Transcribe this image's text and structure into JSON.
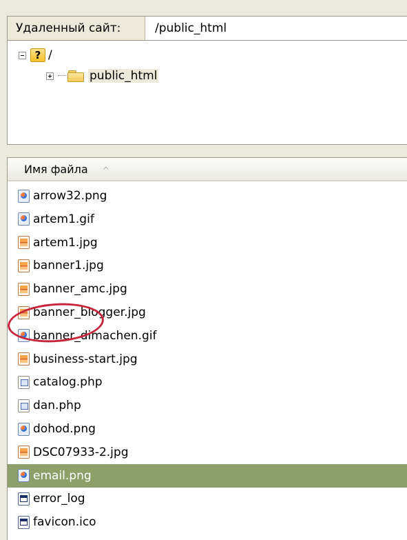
{
  "remote_site": {
    "label": "Удаленный сайт:",
    "path": "/public_html"
  },
  "tree": {
    "root_label": "/",
    "child_label": "public_html"
  },
  "file_list": {
    "column_header": "Имя файла",
    "sort_indicator": "^",
    "selected_index": 12,
    "files": [
      {
        "name": "arrow32.png",
        "icon": "png-file-icon"
      },
      {
        "name": "artem1.gif",
        "icon": "gif-file-icon"
      },
      {
        "name": "artem1.jpg",
        "icon": "jpg-file-icon"
      },
      {
        "name": "banner1.jpg",
        "icon": "jpg-file-icon"
      },
      {
        "name": "banner_amc.jpg",
        "icon": "jpg-file-icon"
      },
      {
        "name": "banner_blogger.jpg",
        "icon": "jpg-file-icon"
      },
      {
        "name": "banner_dimachen.gif",
        "icon": "gif-file-icon"
      },
      {
        "name": "business-start.jpg",
        "icon": "jpg-file-icon"
      },
      {
        "name": "catalog.php",
        "icon": "php-file-icon"
      },
      {
        "name": "dan.php",
        "icon": "php-file-icon"
      },
      {
        "name": "dohod.png",
        "icon": "png-file-icon"
      },
      {
        "name": "DSC07933-2.jpg",
        "icon": "jpg-file-icon"
      },
      {
        "name": "email.png",
        "icon": "png-file-icon"
      },
      {
        "name": "error_log",
        "icon": "log-file-icon"
      },
      {
        "name": "favicon.ico",
        "icon": "ico-file-icon"
      }
    ]
  },
  "colors": {
    "selection": "#8ea06a",
    "highlight_ring": "#c8243a"
  }
}
